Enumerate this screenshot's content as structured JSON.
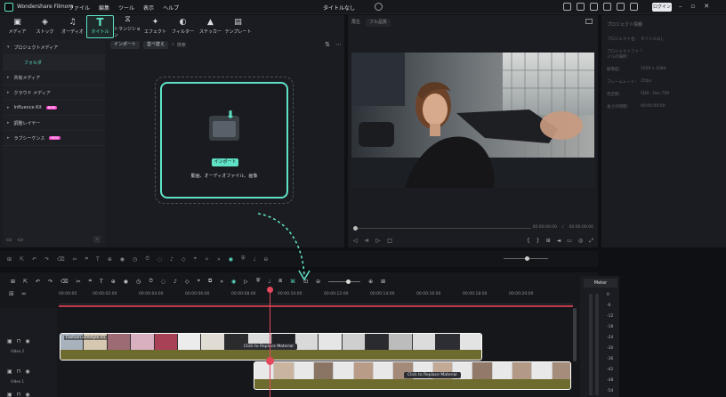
{
  "app": {
    "name": "Wondershare Filmora",
    "project": "タイトルなし",
    "login": "ログイン"
  },
  "menu": [
    "ファイル",
    "編集",
    "ツール",
    "表示",
    "ヘルプ"
  ],
  "tabs": [
    {
      "label": "メディア",
      "icon": "media-icon"
    },
    {
      "label": "ストック",
      "icon": "stock-icon"
    },
    {
      "label": "オーディオ",
      "icon": "music-icon"
    },
    {
      "label": "タイトル",
      "icon": "title-icon"
    },
    {
      "label": "トランジション",
      "icon": "transition-icon"
    },
    {
      "label": "エフェクト",
      "icon": "effect-icon"
    },
    {
      "label": "フィルター",
      "icon": "filter-icon"
    },
    {
      "label": "ステッカー",
      "icon": "sticker-icon"
    },
    {
      "label": "テンプレート",
      "icon": "template-icon"
    }
  ],
  "sidebar": {
    "items": [
      {
        "label": "プロジェクトメディア",
        "badge": ""
      },
      {
        "label": "フォルダ",
        "badge": ""
      },
      {
        "label": "共有メディア",
        "badge": ""
      },
      {
        "label": "クラウド メディア",
        "badge": ""
      },
      {
        "label": "Influence Kit",
        "badge": "NEW"
      },
      {
        "label": "調整レイヤー",
        "badge": ""
      },
      {
        "label": "ラブシーケンス",
        "badge": "NEW"
      }
    ]
  },
  "media_toolbar": {
    "import": "インポート",
    "sort": "並べ替え",
    "search_placeholder": "検索"
  },
  "import_box": {
    "button": "インポート",
    "hint": "動画、オーディオファイル、画像"
  },
  "preview": {
    "quality": "フル品質",
    "player": "再生",
    "time_current": "00:00:00:00",
    "time_total": "00:00:00:00"
  },
  "properties": {
    "title": "プロジェクト情報",
    "rows": [
      {
        "k": "プロジェクト名：",
        "v": "タイトルなし"
      },
      {
        "k": "プロジェクトファイルの場所：",
        "v": "/"
      },
      {
        "k": "解像度：",
        "v": "1920 x 1080"
      },
      {
        "k": "フレームレート：",
        "v": "25fps"
      },
      {
        "k": "色空間：",
        "v": "SDR - Rec.709"
      },
      {
        "k": "長さの時間：",
        "v": "00:00:00:00"
      }
    ]
  },
  "timeline": {
    "ticks": [
      "00:00:00",
      "00:00:02:00",
      "00:00:04:00",
      "00:00:06:00",
      "00:00:08:00",
      "00:00:10:00",
      "00:00:12:00",
      "00:00:14:00",
      "00:00:16:00",
      "00:00:18:00",
      "00:00:20:00"
    ],
    "tracks": [
      {
        "name": "Video 2"
      },
      {
        "name": "Video 1"
      }
    ],
    "clip1_label": "Fashion Lifestyle 01",
    "replace_label": "Click to Replace Material"
  },
  "meter": {
    "title": "Meter",
    "labels": [
      "0",
      "-6",
      "-12",
      "-18",
      "-24",
      "-30",
      "-36",
      "-42",
      "-48",
      "-54"
    ]
  },
  "colors": {
    "accent": "#5ee1c5",
    "playhead": "#e2475c",
    "panel": "#1b1c21"
  }
}
